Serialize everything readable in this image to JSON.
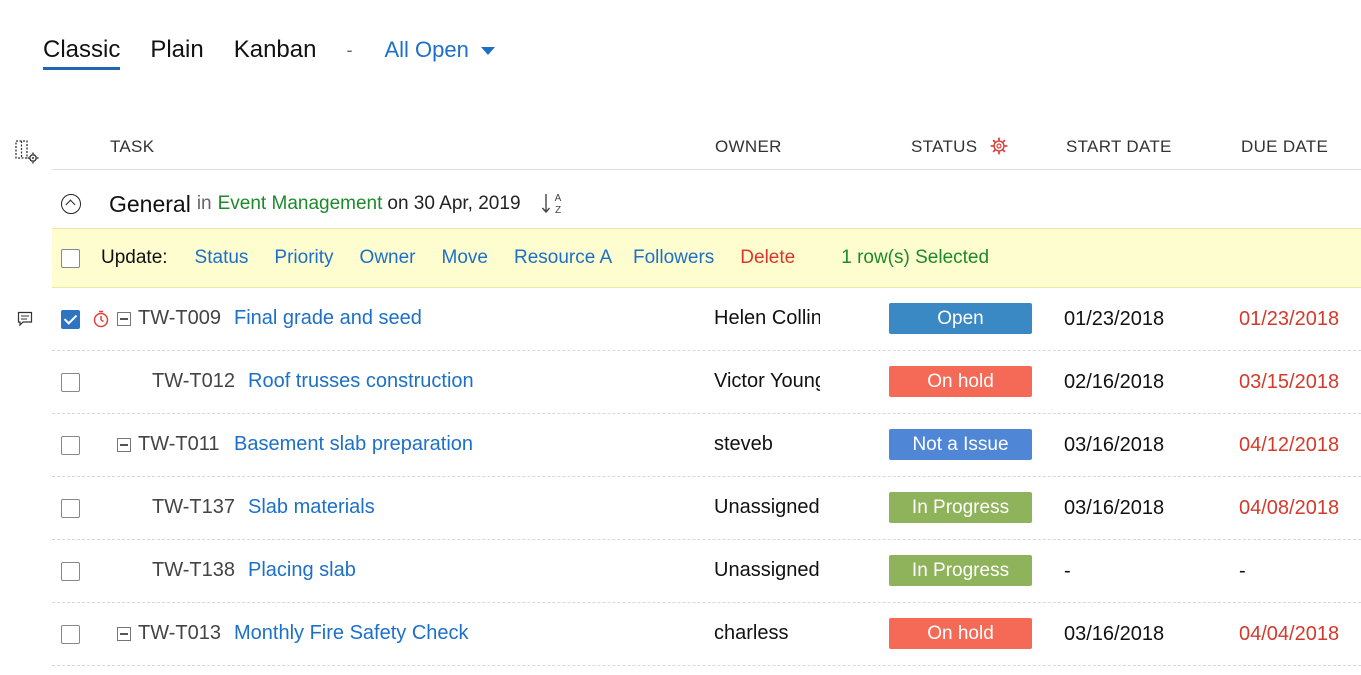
{
  "views": {
    "tabs": [
      "Classic",
      "Plain",
      "Kanban"
    ],
    "separator": "-",
    "filter": "All Open"
  },
  "columns": {
    "task": "TASK",
    "owner": "OWNER",
    "status": "STATUS",
    "start": "START DATE",
    "due": "DUE DATE"
  },
  "group": {
    "name": "General",
    "in": "in",
    "project": "Event Management",
    "on": "on 30 Apr, 2019",
    "sort_top": "A",
    "sort_bottom": "Z"
  },
  "update_bar": {
    "label": "Update:",
    "actions": [
      "Status",
      "Priority",
      "Owner",
      "Move",
      "Resource A",
      "Followers"
    ],
    "delete": "Delete",
    "selected": "1  row(s)  Selected"
  },
  "rows": [
    {
      "id": "TW-T009",
      "name": "Final grade and seed",
      "owner": "Helen Collins",
      "status": "Open",
      "status_color": "#3a88c4",
      "start": "01/23/2018",
      "due": "01/23/2018",
      "checked": true,
      "timer": true,
      "expandable": true,
      "indent": 0
    },
    {
      "id": "TW-T012",
      "name": "Roof trusses construction",
      "owner": "Victor Young",
      "status": "On hold",
      "status_color": "#f56a57",
      "start": "02/16/2018",
      "due": "03/15/2018",
      "checked": false,
      "timer": false,
      "expandable": false,
      "indent": 1
    },
    {
      "id": "TW-T011",
      "name": "Basement slab preparation",
      "owner": "steveb",
      "status": "Not a Issue",
      "status_color": "#4f86d6",
      "start": "03/16/2018",
      "due": "04/12/2018",
      "checked": false,
      "timer": false,
      "expandable": true,
      "indent": 0
    },
    {
      "id": "TW-T137",
      "name": "Slab materials",
      "owner": "Unassigned",
      "status": "In Progress",
      "status_color": "#8fb35b",
      "start": "03/16/2018",
      "due": "04/08/2018",
      "checked": false,
      "timer": false,
      "expandable": false,
      "indent": 1
    },
    {
      "id": "TW-T138",
      "name": "Placing slab",
      "owner": "Unassigned",
      "status": "In Progress",
      "status_color": "#8fb35b",
      "start": "-",
      "due": "-",
      "checked": false,
      "timer": false,
      "expandable": false,
      "indent": 1
    },
    {
      "id": "TW-T013",
      "name": "Monthly Fire Safety Check",
      "owner": "charless",
      "status": "On hold",
      "status_color": "#f56a57",
      "start": "03/16/2018",
      "due": "04/04/2018",
      "checked": false,
      "timer": false,
      "expandable": true,
      "indent": 0
    }
  ]
}
